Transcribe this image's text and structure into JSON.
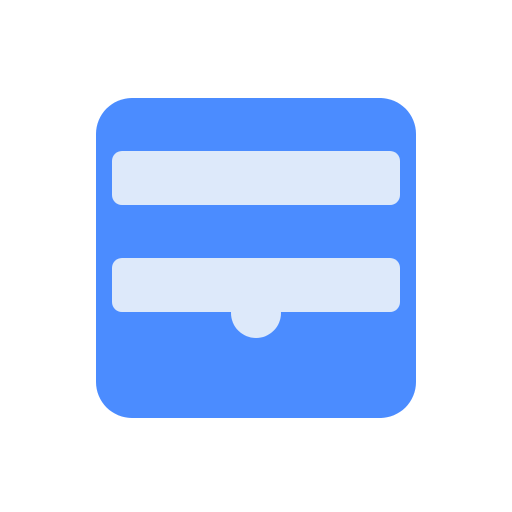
{
  "icon": {
    "name": "drawer-icon",
    "colors": {
      "tile": "#4b8cff",
      "bar": "#dde9fa",
      "background": "#ffffff"
    }
  }
}
